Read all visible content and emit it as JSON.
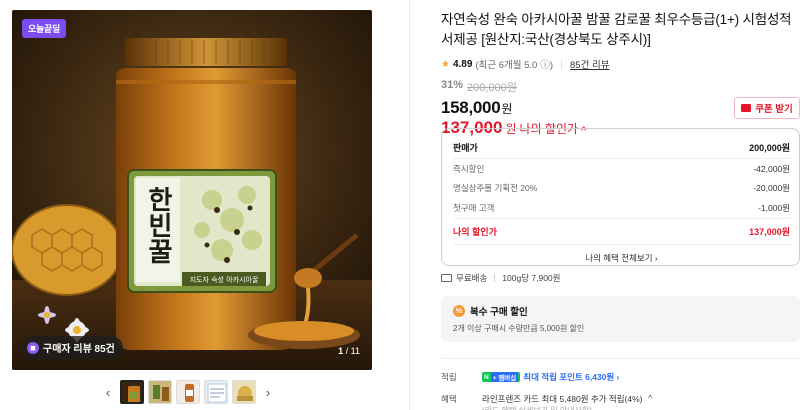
{
  "gallery": {
    "badge": "오늘끝딜",
    "review_chip": "구매자 리뷰 85건",
    "counter_current": "1",
    "counter_total": "/ 11",
    "jar_label_main": "한빈꿀",
    "jar_label_sub": "지도자 숙성 아카시아꿀"
  },
  "product": {
    "title": "자연숙성 완숙 아카시아꿀 밤꿀 감로꿀 최우수등급(1+) 시험성적서제공 [원산지:국산(경상북도 상주시)]",
    "rating": "4.89",
    "rating_note": "(최근 6개월 5.0",
    "rating_info_icon": "ⓘ)",
    "review_link": "85건 리뷰",
    "discount_pct": "31%",
    "original_price": "200,000원",
    "sale_price": "158,000",
    "won": "원",
    "my_price": "137,000",
    "my_price_label": "나의 할인가",
    "coupon_button": "쿠폰 받기"
  },
  "breakdown": {
    "head_label": "판매가",
    "head_value": "200,000원",
    "rows": [
      {
        "label": "즉시할인",
        "value": "-42,000원"
      },
      {
        "label": "명실상주몰 기획전 20%",
        "value": "-20,000원"
      },
      {
        "label": "첫구매 고객",
        "value": "-1,000원"
      }
    ],
    "mine_label": "나의 할인가",
    "mine_value": "137,000원",
    "more_link": "나의 혜택 전체보기 ›"
  },
  "shipping": {
    "free": "무료배송",
    "unit_price": "100g당 7,900원"
  },
  "multi_buy": {
    "title": "복수 구매 할인",
    "icon": "%",
    "desc": "2개 이상 구매시 수량만큼 5,000원 할인"
  },
  "benefits": {
    "points_label": "적립",
    "npay_n": "N",
    "npay_plus": "+ 멤버십",
    "points_text": "최대 적립 포인트",
    "points_value": "6,430원 ›",
    "benefit_label": "혜택",
    "card_text": "라인프렌즈 카드 최대 5,480원 추가 적립(4%)",
    "cut_text": "(카드 혜택 상세보기 및 안내사항)"
  },
  "colors": {
    "accent_red": "#e5162b",
    "badge_purple": "#7b4cf2",
    "point_blue": "#2b6cf6",
    "npay_green": "#0ac85a"
  }
}
